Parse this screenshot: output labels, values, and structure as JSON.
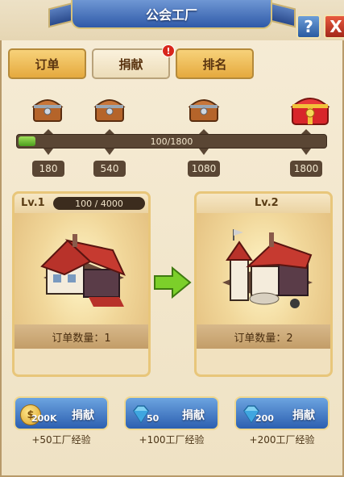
{
  "header": {
    "title": "公会工厂",
    "help_label": "?",
    "close_label": "X"
  },
  "tabs": [
    {
      "label": "订单",
      "active": false
    },
    {
      "label": "捐献",
      "active": true
    },
    {
      "label": "排名",
      "active": false
    }
  ],
  "tab_alert": "!",
  "progress": {
    "text": "100/1800",
    "current": 100,
    "max": 1800,
    "milestones": [
      "180",
      "540",
      "1080",
      "1800"
    ]
  },
  "cards": [
    {
      "level": "Lv.1",
      "exp": "100 / 4000",
      "order_text": "订单数量：1"
    },
    {
      "level": "Lv.2",
      "order_text": "订单数量：2"
    }
  ],
  "donations": [
    {
      "cost": "200K",
      "label": "捐献",
      "reward": "+50工厂经验",
      "currency": "coin"
    },
    {
      "cost": "50",
      "label": "捐献",
      "reward": "+100工厂经验",
      "currency": "gem"
    },
    {
      "cost": "200",
      "label": "捐献",
      "reward": "+200工厂经验",
      "currency": "gem"
    }
  ],
  "colors": {
    "panel_bg": "#f3e6cb",
    "banner_blue": "#2f5aa8",
    "gold_tab": "#e5a93e",
    "progress_green": "#4c9e1e",
    "button_blue": "#2c5fb0"
  }
}
